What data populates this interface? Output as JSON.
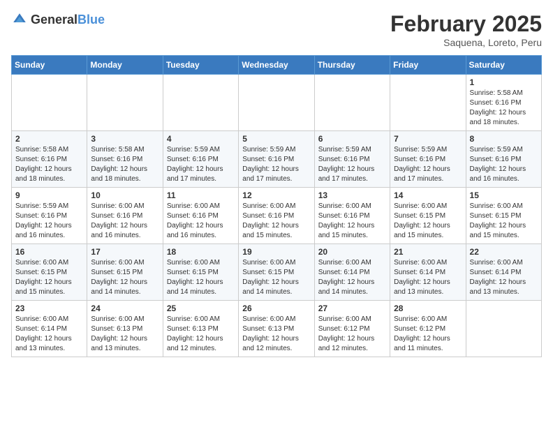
{
  "header": {
    "logo": {
      "general": "General",
      "blue": "Blue"
    },
    "title": "February 2025",
    "location": "Saquena, Loreto, Peru"
  },
  "weekdays": [
    "Sunday",
    "Monday",
    "Tuesday",
    "Wednesday",
    "Thursday",
    "Friday",
    "Saturday"
  ],
  "weeks": [
    [
      {
        "day": "",
        "info": ""
      },
      {
        "day": "",
        "info": ""
      },
      {
        "day": "",
        "info": ""
      },
      {
        "day": "",
        "info": ""
      },
      {
        "day": "",
        "info": ""
      },
      {
        "day": "",
        "info": ""
      },
      {
        "day": "1",
        "info": "Sunrise: 5:58 AM\nSunset: 6:16 PM\nDaylight: 12 hours\nand 18 minutes."
      }
    ],
    [
      {
        "day": "2",
        "info": "Sunrise: 5:58 AM\nSunset: 6:16 PM\nDaylight: 12 hours\nand 18 minutes."
      },
      {
        "day": "3",
        "info": "Sunrise: 5:58 AM\nSunset: 6:16 PM\nDaylight: 12 hours\nand 18 minutes."
      },
      {
        "day": "4",
        "info": "Sunrise: 5:59 AM\nSunset: 6:16 PM\nDaylight: 12 hours\nand 17 minutes."
      },
      {
        "day": "5",
        "info": "Sunrise: 5:59 AM\nSunset: 6:16 PM\nDaylight: 12 hours\nand 17 minutes."
      },
      {
        "day": "6",
        "info": "Sunrise: 5:59 AM\nSunset: 6:16 PM\nDaylight: 12 hours\nand 17 minutes."
      },
      {
        "day": "7",
        "info": "Sunrise: 5:59 AM\nSunset: 6:16 PM\nDaylight: 12 hours\nand 17 minutes."
      },
      {
        "day": "8",
        "info": "Sunrise: 5:59 AM\nSunset: 6:16 PM\nDaylight: 12 hours\nand 16 minutes."
      }
    ],
    [
      {
        "day": "9",
        "info": "Sunrise: 5:59 AM\nSunset: 6:16 PM\nDaylight: 12 hours\nand 16 minutes."
      },
      {
        "day": "10",
        "info": "Sunrise: 6:00 AM\nSunset: 6:16 PM\nDaylight: 12 hours\nand 16 minutes."
      },
      {
        "day": "11",
        "info": "Sunrise: 6:00 AM\nSunset: 6:16 PM\nDaylight: 12 hours\nand 16 minutes."
      },
      {
        "day": "12",
        "info": "Sunrise: 6:00 AM\nSunset: 6:16 PM\nDaylight: 12 hours\nand 15 minutes."
      },
      {
        "day": "13",
        "info": "Sunrise: 6:00 AM\nSunset: 6:16 PM\nDaylight: 12 hours\nand 15 minutes."
      },
      {
        "day": "14",
        "info": "Sunrise: 6:00 AM\nSunset: 6:15 PM\nDaylight: 12 hours\nand 15 minutes."
      },
      {
        "day": "15",
        "info": "Sunrise: 6:00 AM\nSunset: 6:15 PM\nDaylight: 12 hours\nand 15 minutes."
      }
    ],
    [
      {
        "day": "16",
        "info": "Sunrise: 6:00 AM\nSunset: 6:15 PM\nDaylight: 12 hours\nand 15 minutes."
      },
      {
        "day": "17",
        "info": "Sunrise: 6:00 AM\nSunset: 6:15 PM\nDaylight: 12 hours\nand 14 minutes."
      },
      {
        "day": "18",
        "info": "Sunrise: 6:00 AM\nSunset: 6:15 PM\nDaylight: 12 hours\nand 14 minutes."
      },
      {
        "day": "19",
        "info": "Sunrise: 6:00 AM\nSunset: 6:15 PM\nDaylight: 12 hours\nand 14 minutes."
      },
      {
        "day": "20",
        "info": "Sunrise: 6:00 AM\nSunset: 6:14 PM\nDaylight: 12 hours\nand 14 minutes."
      },
      {
        "day": "21",
        "info": "Sunrise: 6:00 AM\nSunset: 6:14 PM\nDaylight: 12 hours\nand 13 minutes."
      },
      {
        "day": "22",
        "info": "Sunrise: 6:00 AM\nSunset: 6:14 PM\nDaylight: 12 hours\nand 13 minutes."
      }
    ],
    [
      {
        "day": "23",
        "info": "Sunrise: 6:00 AM\nSunset: 6:14 PM\nDaylight: 12 hours\nand 13 minutes."
      },
      {
        "day": "24",
        "info": "Sunrise: 6:00 AM\nSunset: 6:13 PM\nDaylight: 12 hours\nand 13 minutes."
      },
      {
        "day": "25",
        "info": "Sunrise: 6:00 AM\nSunset: 6:13 PM\nDaylight: 12 hours\nand 12 minutes."
      },
      {
        "day": "26",
        "info": "Sunrise: 6:00 AM\nSunset: 6:13 PM\nDaylight: 12 hours\nand 12 minutes."
      },
      {
        "day": "27",
        "info": "Sunrise: 6:00 AM\nSunset: 6:12 PM\nDaylight: 12 hours\nand 12 minutes."
      },
      {
        "day": "28",
        "info": "Sunrise: 6:00 AM\nSunset: 6:12 PM\nDaylight: 12 hours\nand 11 minutes."
      },
      {
        "day": "",
        "info": ""
      }
    ]
  ]
}
